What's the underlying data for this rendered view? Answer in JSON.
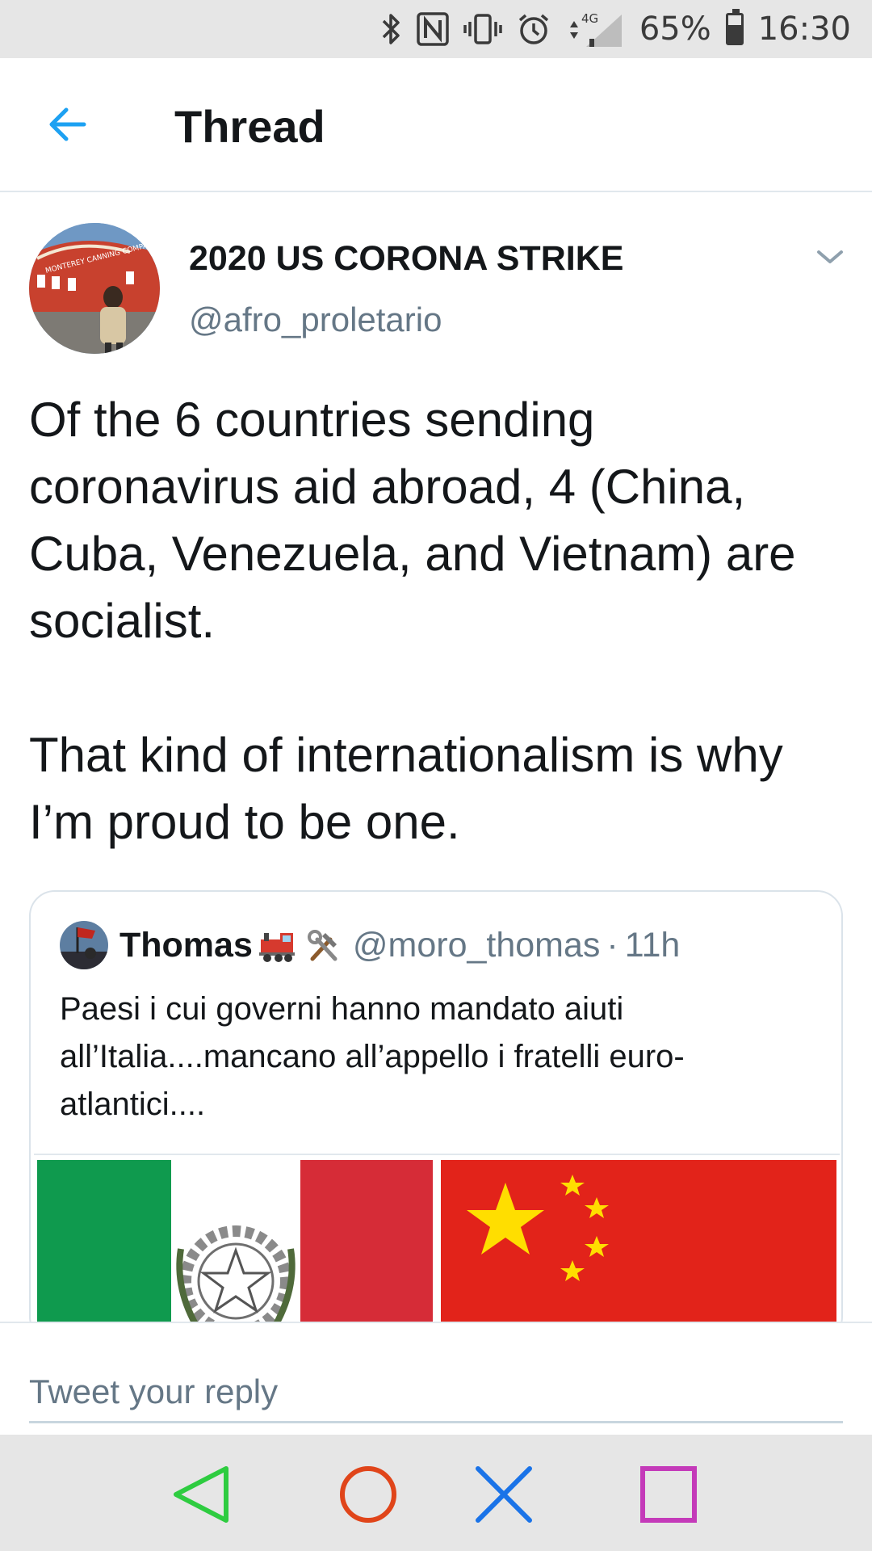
{
  "status_bar": {
    "battery_percent": "65%",
    "battery_level": 0.65,
    "network_label": "4G",
    "time": "16:30",
    "icons": [
      "bluetooth-icon",
      "nfc-icon",
      "vibrate-icon",
      "alarm-icon",
      "signal-icon",
      "battery-icon"
    ]
  },
  "header": {
    "title": "Thread",
    "back_icon": "arrow-left-icon",
    "accent_color": "#1da1f2"
  },
  "tweet": {
    "author_name": "2020 US CORONA STRIKE",
    "author_handle": "@afro_proletario",
    "avatar_sign_text": "MONTEREY CANNING COMPANY",
    "text_p1": "Of the 6 countries sending coronavirus aid abroad, 4 (China, Cuba, Venezuela, and Vietnam) are socialist.",
    "text_p2": "That kind of internationalism is why I’m proud to be one."
  },
  "quoted_tweet": {
    "author_name": "Thomas",
    "emoji": [
      "locomotive-emoji",
      "hammer-and-wrench-emoji"
    ],
    "author_handle": "@moro_thomas",
    "separator": "·",
    "time_ago": "11h",
    "text": "Paesi i cui governi hanno mandato aiuti all’Italia....mancano all’appello  i fratelli euro-atlantici....",
    "media": [
      "italy-flag-with-emblem",
      "china-flag"
    ]
  },
  "reply": {
    "placeholder": "Tweet your reply"
  },
  "nav_bar": {
    "buttons": [
      "back-triangle",
      "home-circle",
      "cross",
      "recents-square"
    ],
    "colors": {
      "back": "#2ecc40",
      "home": "#e0451a",
      "cross": "#1a73e8",
      "recents": "#c43ab9"
    }
  }
}
